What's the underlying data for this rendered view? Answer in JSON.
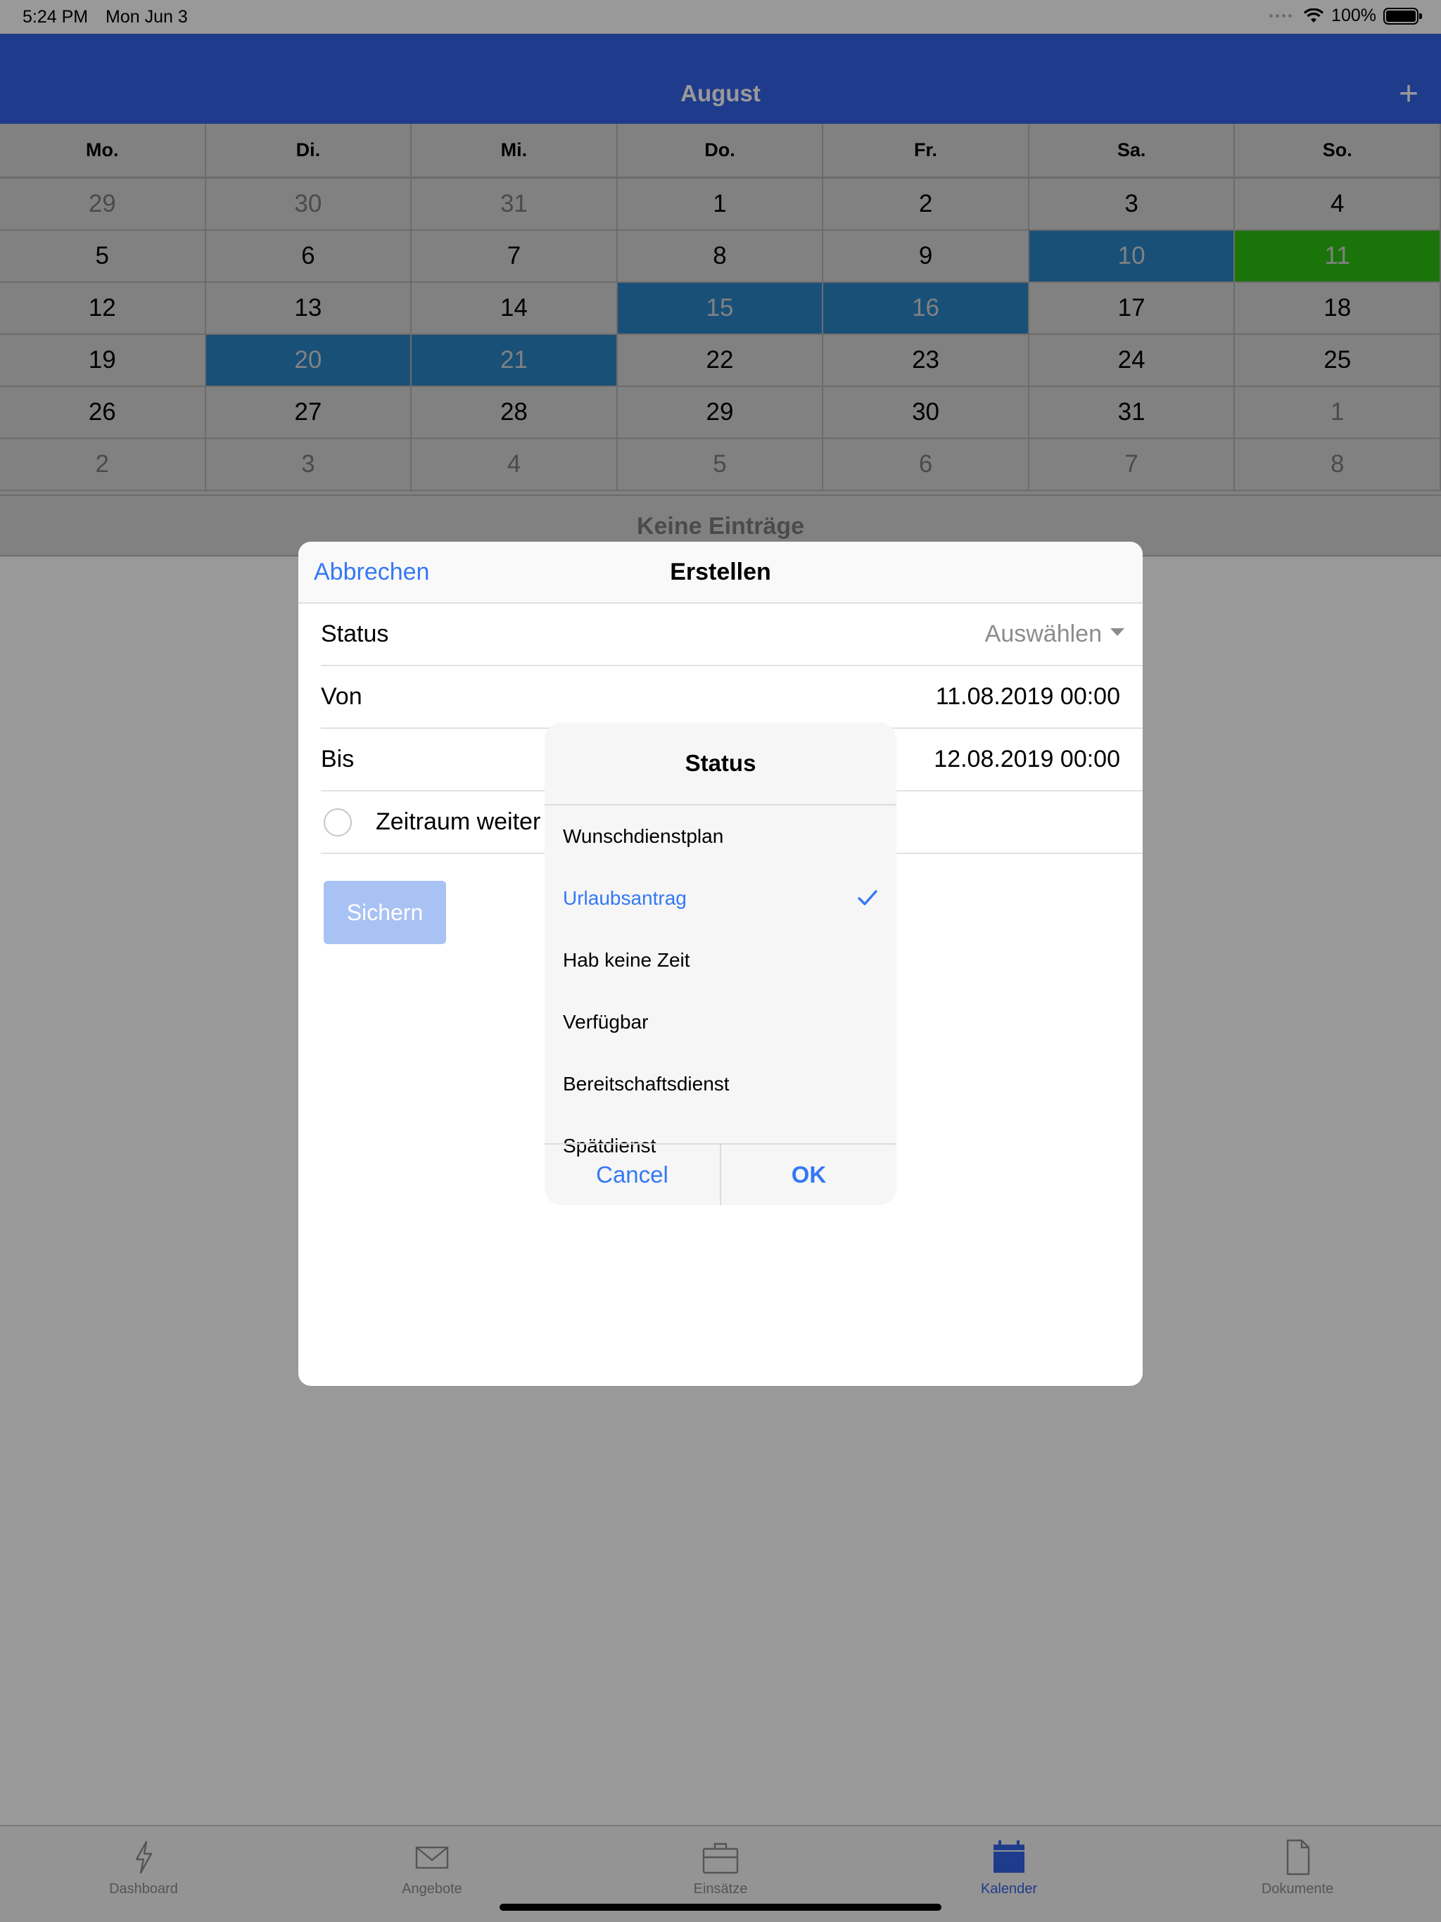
{
  "status_bar": {
    "time": "5:24 PM",
    "date": "Mon Jun 3",
    "battery": "100%"
  },
  "nav": {
    "title": "August",
    "add_label": "+"
  },
  "calendar": {
    "weekdays": [
      "Mo.",
      "Di.",
      "Mi.",
      "Do.",
      "Fr.",
      "Sa.",
      "So."
    ],
    "weeks": [
      [
        "29",
        "30",
        "31",
        "1",
        "2",
        "3",
        "4"
      ],
      [
        "5",
        "6",
        "7",
        "8",
        "9",
        "10",
        "11"
      ],
      [
        "12",
        "13",
        "14",
        "15",
        "16",
        "17",
        "18"
      ],
      [
        "19",
        "20",
        "21",
        "22",
        "23",
        "24",
        "25"
      ],
      [
        "26",
        "27",
        "28",
        "29",
        "30",
        "31",
        "1"
      ],
      [
        "2",
        "3",
        "4",
        "5",
        "6",
        "7",
        "8"
      ]
    ],
    "highlight_color": "#2a85c9",
    "today_color": "#2cc212"
  },
  "empty_state": "Keine Einträge",
  "sheet": {
    "cancel_label": "Abbrechen",
    "title": "Erstellen",
    "status_label": "Status",
    "status_placeholder": "Auswählen",
    "von_label": "Von",
    "von_value": "11.08.2019 00:00",
    "bis_label": "Bis",
    "bis_value": "12.08.2019 00:00",
    "zeitraum_label": "Zeitraum weiter",
    "save_label": "Sichern"
  },
  "picker": {
    "title": "Status",
    "options": [
      "Wunschdienstplan",
      "Urlaubsantrag",
      "Hab keine Zeit",
      "Verfügbar",
      "Bereitschaftsdienst",
      "Spätdienst"
    ],
    "selected": "Urlaubsantrag",
    "cancel_label": "Cancel",
    "ok_label": "OK"
  },
  "tabs": [
    {
      "label": "Dashboard",
      "icon": "bolt-icon"
    },
    {
      "label": "Angebote",
      "icon": "envelope-icon"
    },
    {
      "label": "Einsätze",
      "icon": "briefcase-icon"
    },
    {
      "label": "Kalender",
      "icon": "calendar-icon",
      "active": true
    },
    {
      "label": "Dokumente",
      "icon": "document-icon"
    }
  ],
  "colors": {
    "accent": "#3563e8",
    "link": "#3478f6"
  }
}
